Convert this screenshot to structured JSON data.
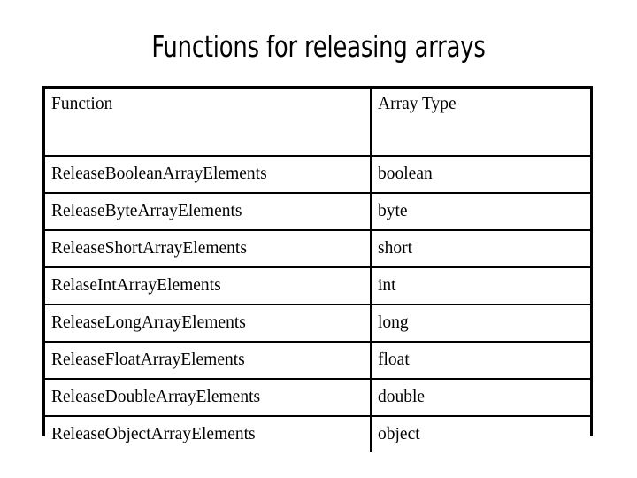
{
  "slide": {
    "title": "Functions for releasing arrays"
  },
  "table": {
    "columns": [
      "Function",
      "Array Type"
    ],
    "rows": [
      {
        "function": "ReleaseBooleanArrayElements",
        "array_type": "boolean"
      },
      {
        "function": "ReleaseByteArrayElements",
        "array_type": "byte"
      },
      {
        "function": "ReleaseShortArrayElements",
        "array_type": "short"
      },
      {
        "function": "RelaseIntArrayElements",
        "array_type": "int"
      },
      {
        "function": "ReleaseLongArrayElements",
        "array_type": "long"
      },
      {
        "function": "ReleaseFloatArrayElements",
        "array_type": "float"
      },
      {
        "function": "ReleaseDoubleArrayElements",
        "array_type": "double"
      },
      {
        "function": "ReleaseObjectArrayElements",
        "array_type": "object"
      }
    ]
  },
  "colors": {
    "background": "#ffffff",
    "text": "#000000",
    "border": "#000000"
  }
}
